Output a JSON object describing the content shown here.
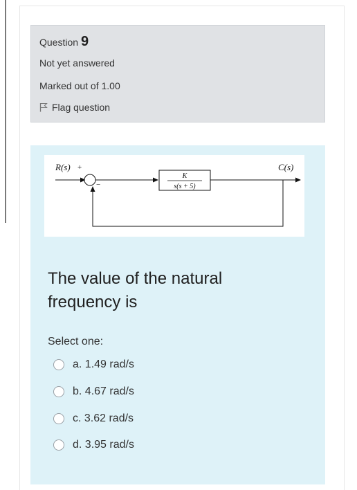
{
  "question": {
    "label": "Question",
    "number": "9",
    "status": "Not yet answered",
    "marks": "Marked out of 1.00",
    "flag_label": "Flag question"
  },
  "diagram": {
    "input_label": "R(s)",
    "plus_sign": "+",
    "minus_sign": "−",
    "numerator": "K",
    "denominator": "s(s + 5)",
    "output_label": "C(s)"
  },
  "prompt": "The value of the natural frequency is",
  "select_label": "Select one:",
  "options": [
    {
      "label": "a. 1.49 rad/s"
    },
    {
      "label": "b. 4.67 rad/s"
    },
    {
      "label": "c. 3.62 rad/s"
    },
    {
      "label": "d. 3.95 rad/s"
    }
  ]
}
